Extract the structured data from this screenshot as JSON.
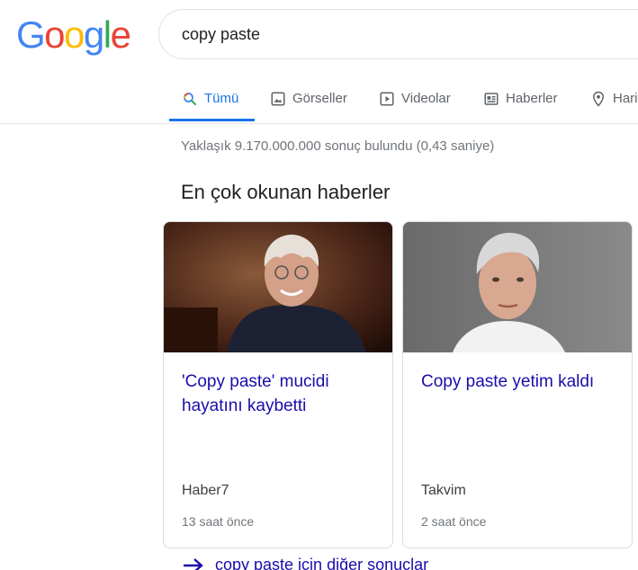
{
  "logo": {
    "letters": [
      "G",
      "o",
      "o",
      "g",
      "l",
      "e"
    ],
    "colors": [
      "#4285F4",
      "#EA4335",
      "#FBBC05",
      "#4285F4",
      "#34A853",
      "#EA4335"
    ]
  },
  "search": {
    "query": "copy paste"
  },
  "tabs": [
    {
      "label": "Tümü",
      "icon": "search-icon",
      "active": true
    },
    {
      "label": "Görseller",
      "icon": "image-icon",
      "active": false
    },
    {
      "label": "Videolar",
      "icon": "video-icon",
      "active": false
    },
    {
      "label": "Haberler",
      "icon": "news-icon",
      "active": false
    },
    {
      "label": "Harit",
      "icon": "map-pin-icon",
      "active": false
    }
  ],
  "result_stats": "Yaklaşık 9.170.000.000 sonuç bulundu (0,43 saniye)",
  "top_stories": {
    "title": "En çok okunan haberler",
    "cards": [
      {
        "headline": "'Copy paste' mucidi hayatını kaybetti",
        "source": "Haber7",
        "time": "13 saat önce"
      },
      {
        "headline": "Copy paste yetim kaldı",
        "source": "Takvim",
        "time": "2 saat önce"
      }
    ],
    "more_link": "copy paste için diğer sonuçlar"
  },
  "colors": {
    "accent": "#1a73e8",
    "link": "#1a0dab",
    "muted": "#70757a"
  }
}
